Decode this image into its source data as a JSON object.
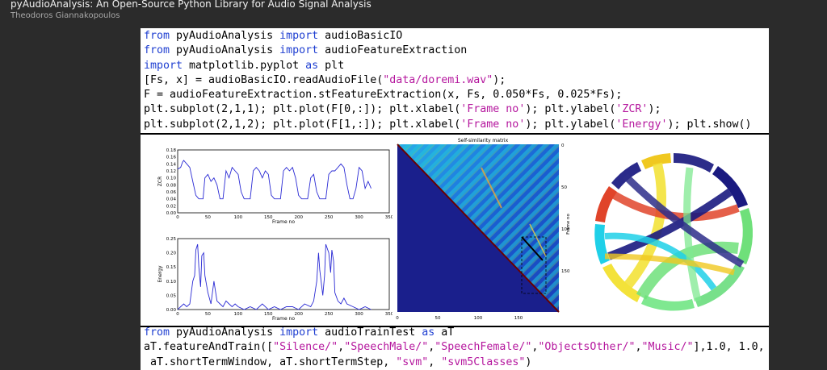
{
  "header": {
    "title": "pyAudioAnalysis: An Open-Source Python Library for Audio Signal Analysis",
    "author": "Theodoros Giannakopoulos"
  },
  "code_top": [
    [
      {
        "t": "from",
        "c": "k"
      },
      {
        "t": " pyAudioAnalysis ",
        "c": ""
      },
      {
        "t": "import",
        "c": "k"
      },
      {
        "t": " audioBasicIO",
        "c": ""
      }
    ],
    [
      {
        "t": "from",
        "c": "k"
      },
      {
        "t": " pyAudioAnalysis ",
        "c": ""
      },
      {
        "t": "import",
        "c": "k"
      },
      {
        "t": " audioFeatureExtraction",
        "c": ""
      }
    ],
    [
      {
        "t": "import",
        "c": "k"
      },
      {
        "t": " matplotlib.pyplot ",
        "c": ""
      },
      {
        "t": "as",
        "c": "k"
      },
      {
        "t": " plt",
        "c": ""
      }
    ],
    [
      {
        "t": "[Fs, x] = audioBasicIO.readAudioFile(",
        "c": ""
      },
      {
        "t": "\"data/doremi.wav\"",
        "c": "s"
      },
      {
        "t": ");",
        "c": ""
      }
    ],
    [
      {
        "t": "F = audioFeatureExtraction.stFeatureExtraction(x, Fs, 0.050*Fs, 0.025*Fs);",
        "c": ""
      }
    ],
    [
      {
        "t": "plt.subplot(2,1,1); plt.plot(F[0,:]); plt.xlabel(",
        "c": ""
      },
      {
        "t": "'Frame no'",
        "c": "s"
      },
      {
        "t": "); plt.ylabel(",
        "c": ""
      },
      {
        "t": "'ZCR'",
        "c": "s"
      },
      {
        "t": ");",
        "c": ""
      }
    ],
    [
      {
        "t": "plt.subplot(2,1,2); plt.plot(F[1,:]); plt.xlabel(",
        "c": ""
      },
      {
        "t": "'Frame no'",
        "c": "s"
      },
      {
        "t": "); plt.ylabel(",
        "c": ""
      },
      {
        "t": "'Energy'",
        "c": "s"
      },
      {
        "t": "); plt.show()",
        "c": ""
      }
    ]
  ],
  "code_bottom": [
    [
      {
        "t": "from",
        "c": "k"
      },
      {
        "t": " pyAudioAnalysis ",
        "c": ""
      },
      {
        "t": "import",
        "c": "k"
      },
      {
        "t": " audioTrainTest ",
        "c": ""
      },
      {
        "t": "as",
        "c": "k"
      },
      {
        "t": " aT",
        "c": ""
      }
    ],
    [
      {
        "t": "aT.featureAndTrain([",
        "c": ""
      },
      {
        "t": "\"Silence/\"",
        "c": "s"
      },
      {
        "t": ",",
        "c": ""
      },
      {
        "t": "\"SpeechMale/\"",
        "c": "s"
      },
      {
        "t": ",",
        "c": ""
      },
      {
        "t": "\"SpeechFemale/\"",
        "c": "s"
      },
      {
        "t": ",",
        "c": ""
      },
      {
        "t": "\"ObjectsOther/\"",
        "c": "s"
      },
      {
        "t": ",",
        "c": ""
      },
      {
        "t": "\"Music/\"",
        "c": "s"
      },
      {
        "t": "],1.0, 1.0,",
        "c": ""
      }
    ],
    [
      {
        "t": " aT.shortTermWindow, aT.shortTermStep, ",
        "c": ""
      },
      {
        "t": "\"svm\"",
        "c": "s"
      },
      {
        "t": ", ",
        "c": ""
      },
      {
        "t": "\"svm5Classes\"",
        "c": "s"
      },
      {
        "t": ")",
        "c": ""
      }
    ]
  ],
  "colors": {
    "keyword": "#1f3fd1",
    "string": "#b5179e",
    "line": "#2a2ad4"
  },
  "chart_data": [
    {
      "type": "line",
      "xlabel": "Frame no",
      "ylabel": "ZCR",
      "xlim": [
        0,
        350
      ],
      "ylim": [
        0,
        0.18
      ],
      "xticks": [
        "0",
        "50",
        "100",
        "150",
        "200",
        "250",
        "300",
        "350"
      ],
      "yticks": [
        "0.00",
        "0.02",
        "0.04",
        "0.06",
        "0.08",
        "0.10",
        "0.12",
        "0.14",
        "0.16",
        "0.18"
      ],
      "x": [
        0,
        5,
        8,
        10,
        15,
        20,
        25,
        30,
        35,
        40,
        42,
        45,
        50,
        55,
        60,
        65,
        70,
        75,
        80,
        85,
        90,
        95,
        100,
        105,
        110,
        115,
        120,
        125,
        130,
        135,
        140,
        145,
        150,
        155,
        160,
        165,
        170,
        175,
        180,
        185,
        190,
        195,
        200,
        205,
        210,
        215,
        220,
        225,
        230,
        235,
        240,
        245,
        250,
        255,
        260,
        265,
        270,
        275,
        280,
        285,
        290,
        295,
        300,
        305,
        310,
        315,
        320
      ],
      "values": [
        0.125,
        0.13,
        0.145,
        0.15,
        0.14,
        0.13,
        0.09,
        0.05,
        0.04,
        0.04,
        0.04,
        0.1,
        0.11,
        0.09,
        0.1,
        0.08,
        0.04,
        0.04,
        0.12,
        0.1,
        0.13,
        0.12,
        0.11,
        0.06,
        0.04,
        0.04,
        0.04,
        0.12,
        0.13,
        0.12,
        0.1,
        0.12,
        0.11,
        0.05,
        0.04,
        0.04,
        0.04,
        0.12,
        0.13,
        0.12,
        0.13,
        0.1,
        0.05,
        0.04,
        0.04,
        0.04,
        0.1,
        0.11,
        0.06,
        0.04,
        0.04,
        0.04,
        0.11,
        0.12,
        0.12,
        0.13,
        0.14,
        0.13,
        0.08,
        0.04,
        0.04,
        0.07,
        0.13,
        0.12,
        0.07,
        0.09,
        0.07
      ]
    },
    {
      "type": "line",
      "xlabel": "Frame no",
      "ylabel": "Energy",
      "xlim": [
        0,
        350
      ],
      "ylim": [
        0,
        0.25
      ],
      "xticks": [
        "0",
        "50",
        "100",
        "150",
        "200",
        "250",
        "300",
        "350"
      ],
      "yticks": [
        "0.00",
        "0.05",
        "0.10",
        "0.15",
        "0.20",
        "0.25"
      ],
      "x": [
        0,
        5,
        10,
        15,
        20,
        25,
        28,
        30,
        33,
        35,
        38,
        40,
        43,
        45,
        50,
        55,
        60,
        65,
        70,
        75,
        80,
        85,
        90,
        95,
        100,
        110,
        120,
        130,
        140,
        150,
        160,
        170,
        180,
        190,
        200,
        210,
        220,
        225,
        230,
        233,
        235,
        240,
        243,
        245,
        250,
        253,
        255,
        258,
        260,
        265,
        270,
        275,
        280,
        290,
        300,
        310,
        320
      ],
      "values": [
        0.0,
        0.01,
        0.02,
        0.01,
        0.02,
        0.1,
        0.12,
        0.21,
        0.23,
        0.15,
        0.08,
        0.19,
        0.2,
        0.12,
        0.06,
        0.02,
        0.1,
        0.03,
        0.02,
        0.01,
        0.03,
        0.02,
        0.01,
        0.02,
        0.01,
        0.0,
        0.01,
        0.0,
        0.02,
        0.0,
        0.01,
        0.0,
        0.01,
        0.01,
        0.0,
        0.02,
        0.01,
        0.03,
        0.1,
        0.2,
        0.14,
        0.05,
        0.12,
        0.23,
        0.2,
        0.13,
        0.21,
        0.17,
        0.06,
        0.03,
        0.02,
        0.04,
        0.02,
        0.01,
        0.0,
        0.01,
        0.0
      ]
    },
    {
      "type": "heatmap",
      "title": "Self-similarity matrix",
      "ylabel": "Frame no",
      "xticks": [
        "0",
        "50",
        "100",
        "150"
      ],
      "yticks": [
        "0",
        "50",
        "100",
        "150"
      ]
    }
  ]
}
